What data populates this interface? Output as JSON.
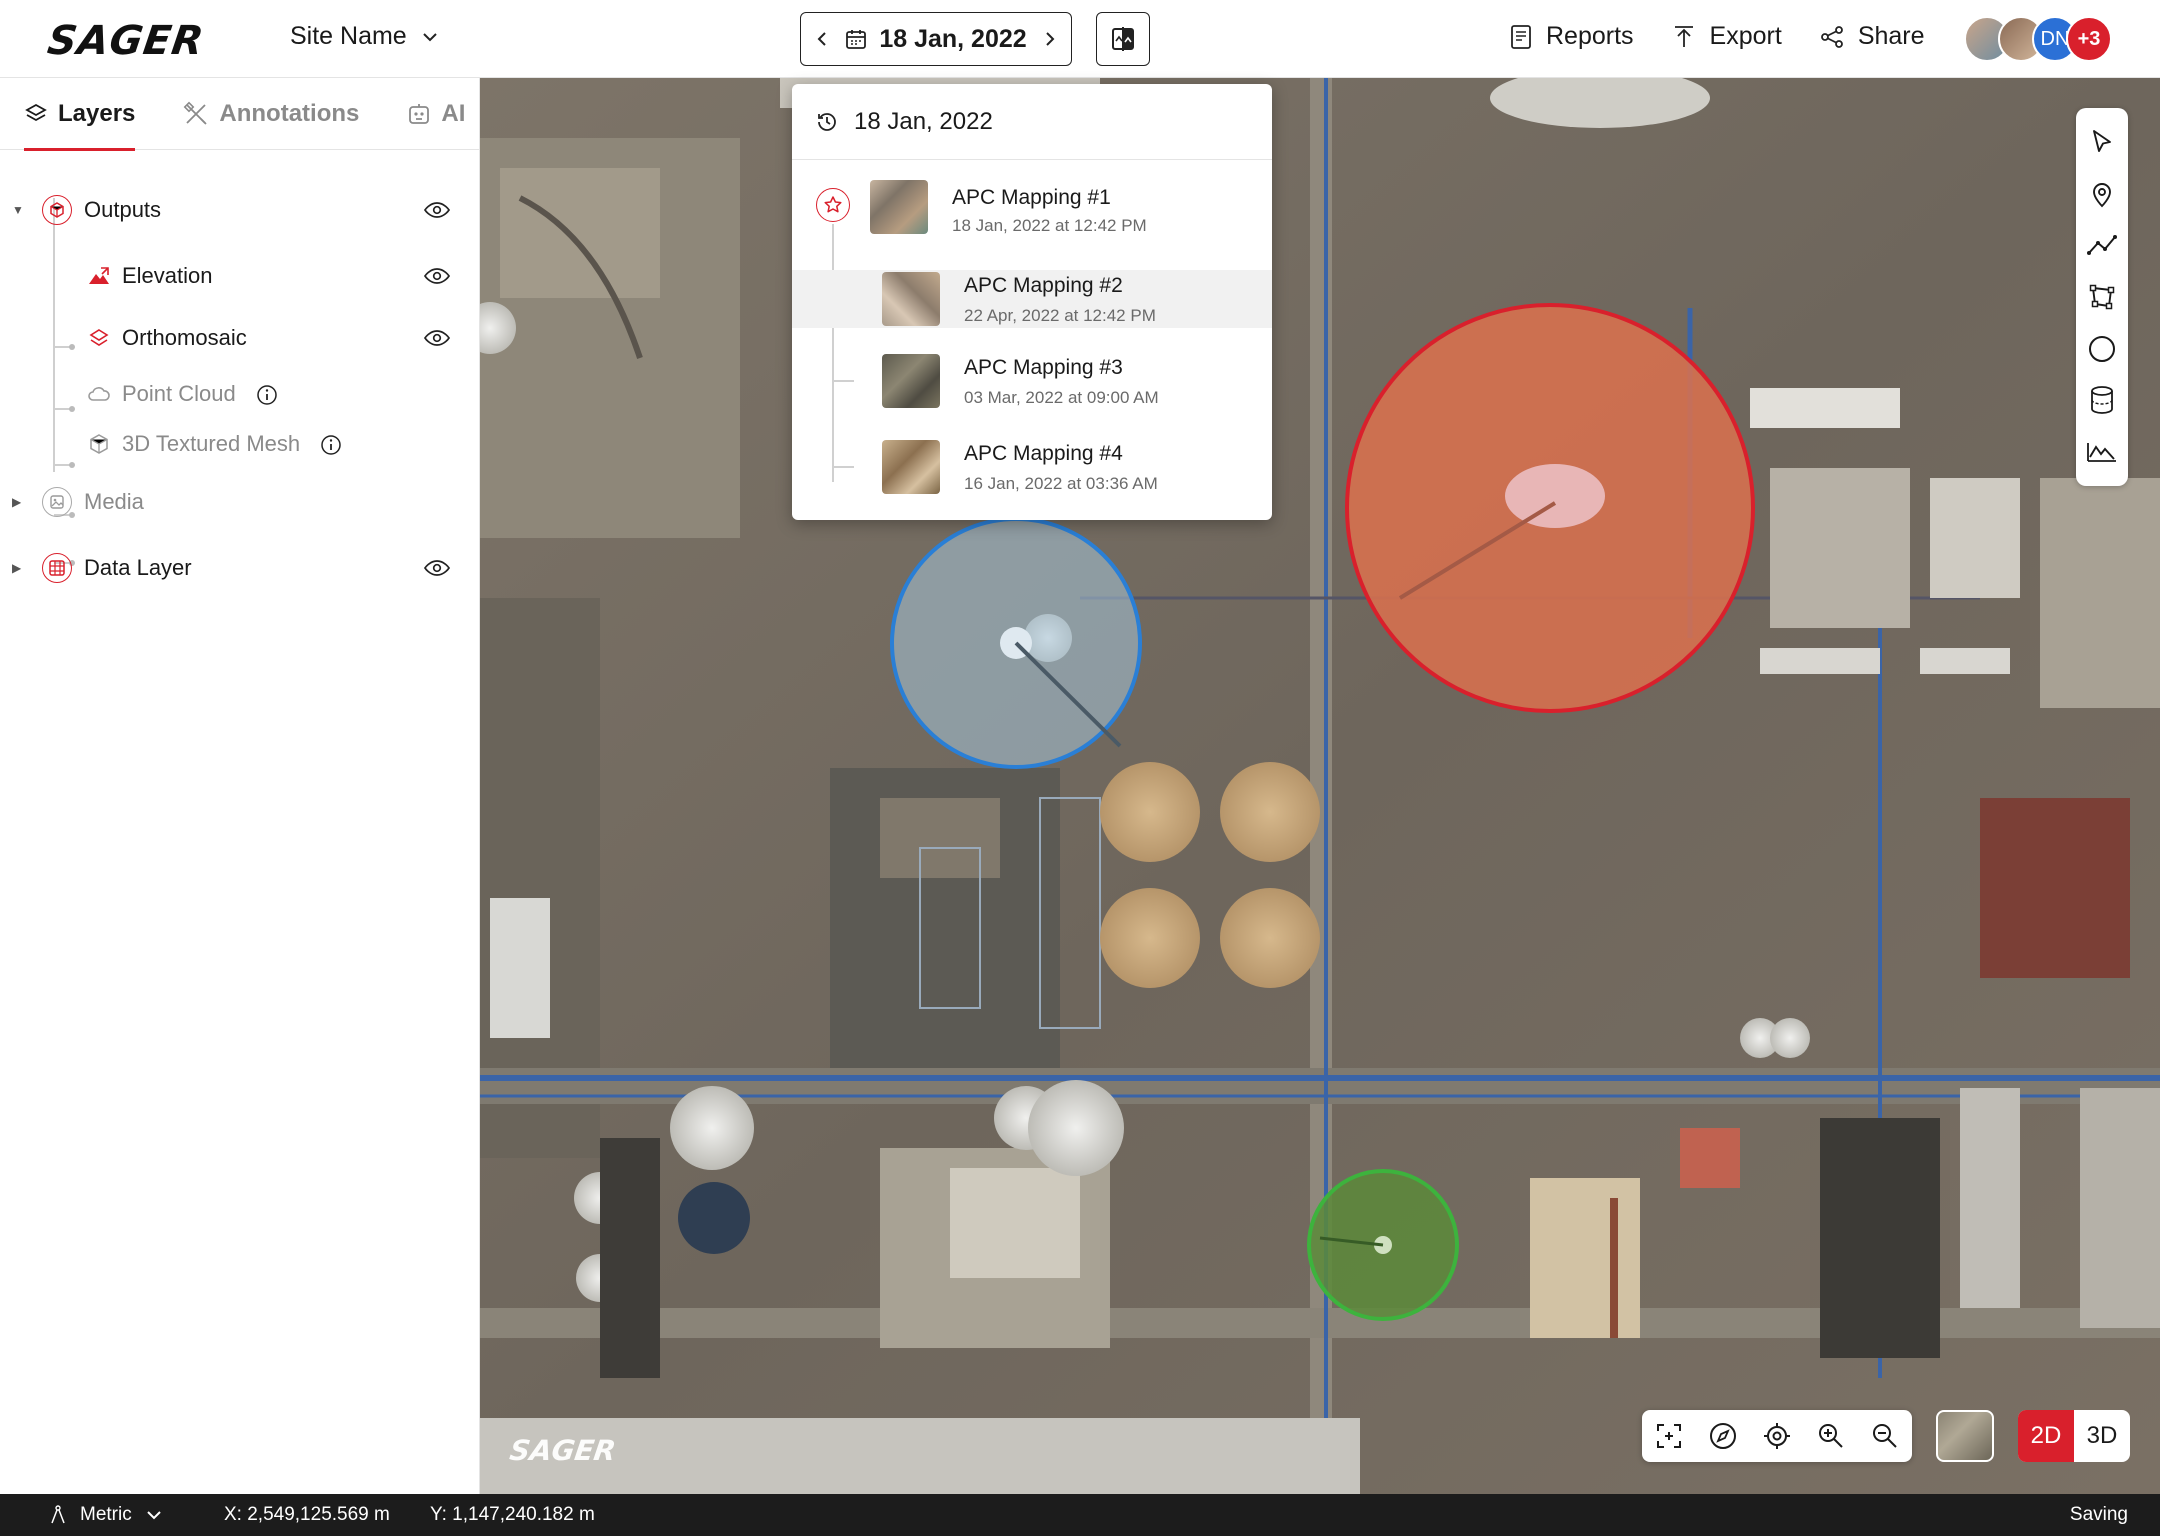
{
  "header": {
    "logo": "SAGER",
    "site_name": "Site Name",
    "date": "18 Jan, 2022",
    "actions": [
      {
        "label": "Reports",
        "icon": "report-icon"
      },
      {
        "label": "Export",
        "icon": "export-icon"
      },
      {
        "label": "Share",
        "icon": "share-icon"
      }
    ],
    "avatars": [
      "",
      "",
      "DN",
      "+3"
    ]
  },
  "sidebar": {
    "tabs": [
      {
        "label": "Layers",
        "icon": "layers-icon",
        "active": true
      },
      {
        "label": "Annotations",
        "icon": "annotations-icon",
        "active": false
      },
      {
        "label": "AI",
        "icon": "ai-icon",
        "active": false
      }
    ],
    "tree": {
      "outputs": "Outputs",
      "elevation": "Elevation",
      "orthomosaic": "Orthomosaic",
      "point_cloud": "Point Cloud",
      "textured_mesh": "3D Textured Mesh",
      "media": "Media",
      "data_layer": "Data Layer"
    }
  },
  "dropdown": {
    "header": "18 Jan, 2022",
    "items": [
      {
        "title": "APC Mapping #1",
        "date": "18 Jan, 2022 at 12:42 PM"
      },
      {
        "title": "APC Mapping #2",
        "date": "22 Apr, 2022 at 12:42 PM"
      },
      {
        "title": "APC Mapping #3",
        "date": "03 Mar, 2022 at 09:00 AM"
      },
      {
        "title": "APC Mapping #4",
        "date": "16 Jan, 2022 at 03:36 AM"
      }
    ]
  },
  "map": {
    "watermark": "SAGER",
    "view_2d": "2D",
    "view_3d": "3D",
    "tools": [
      "select-icon",
      "pin-icon",
      "polyline-icon",
      "polygon-icon",
      "circle-icon",
      "volume-icon",
      "profile-icon"
    ],
    "controls": [
      "fit-extent-icon",
      "compass-icon",
      "locate-icon",
      "zoom-in-icon",
      "zoom-out-icon"
    ],
    "annotation_colors": {
      "blue": "#2a7fd6",
      "red": "#d9202c",
      "green": "#3db33d"
    }
  },
  "status": {
    "units": "Metric",
    "x": "X: 2,549,125.569 m",
    "y": "Y: 1,147,240.182 m",
    "save_state": "Saving"
  },
  "colors": {
    "accent": "#d9202c"
  }
}
